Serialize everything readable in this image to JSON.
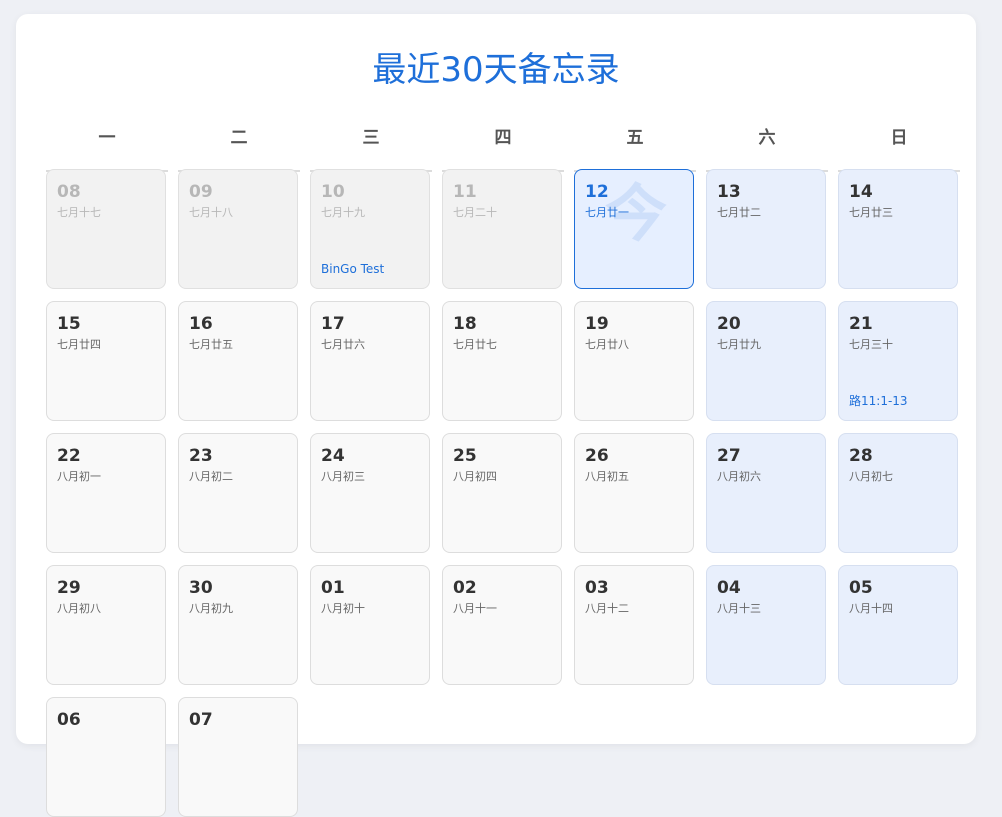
{
  "header": {
    "title": "最近30天备忘录"
  },
  "weekdays": [
    "一",
    "二",
    "三",
    "四",
    "五",
    "六",
    "日"
  ],
  "today_mark": "今",
  "days": [
    {
      "day": "08",
      "lunar": "七月十七",
      "state": "past",
      "memo": ""
    },
    {
      "day": "09",
      "lunar": "七月十八",
      "state": "past",
      "memo": ""
    },
    {
      "day": "10",
      "lunar": "七月十九",
      "state": "past",
      "memo": "BinGo Test"
    },
    {
      "day": "11",
      "lunar": "七月二十",
      "state": "past",
      "memo": ""
    },
    {
      "day": "12",
      "lunar": "七月廿一",
      "state": "today",
      "memo": ""
    },
    {
      "day": "13",
      "lunar": "七月廿二",
      "state": "weekend",
      "memo": ""
    },
    {
      "day": "14",
      "lunar": "七月廿三",
      "state": "weekend",
      "memo": ""
    },
    {
      "day": "15",
      "lunar": "七月廿四",
      "state": "normal",
      "memo": ""
    },
    {
      "day": "16",
      "lunar": "七月廿五",
      "state": "normal",
      "memo": ""
    },
    {
      "day": "17",
      "lunar": "七月廿六",
      "state": "normal",
      "memo": ""
    },
    {
      "day": "18",
      "lunar": "七月廿七",
      "state": "normal",
      "memo": ""
    },
    {
      "day": "19",
      "lunar": "七月廿八",
      "state": "normal",
      "memo": ""
    },
    {
      "day": "20",
      "lunar": "七月廿九",
      "state": "weekend",
      "memo": ""
    },
    {
      "day": "21",
      "lunar": "七月三十",
      "state": "weekend",
      "memo": "路11:1-13"
    },
    {
      "day": "22",
      "lunar": "八月初一",
      "state": "normal",
      "memo": ""
    },
    {
      "day": "23",
      "lunar": "八月初二",
      "state": "normal",
      "memo": ""
    },
    {
      "day": "24",
      "lunar": "八月初三",
      "state": "normal",
      "memo": ""
    },
    {
      "day": "25",
      "lunar": "八月初四",
      "state": "normal",
      "memo": ""
    },
    {
      "day": "26",
      "lunar": "八月初五",
      "state": "normal",
      "memo": ""
    },
    {
      "day": "27",
      "lunar": "八月初六",
      "state": "weekend",
      "memo": ""
    },
    {
      "day": "28",
      "lunar": "八月初七",
      "state": "weekend",
      "memo": ""
    },
    {
      "day": "29",
      "lunar": "八月初八",
      "state": "normal",
      "memo": ""
    },
    {
      "day": "30",
      "lunar": "八月初九",
      "state": "normal",
      "memo": ""
    },
    {
      "day": "01",
      "lunar": "八月初十",
      "state": "normal",
      "memo": ""
    },
    {
      "day": "02",
      "lunar": "八月十一",
      "state": "normal",
      "memo": ""
    },
    {
      "day": "03",
      "lunar": "八月十二",
      "state": "normal",
      "memo": ""
    },
    {
      "day": "04",
      "lunar": "八月十三",
      "state": "weekend",
      "memo": ""
    },
    {
      "day": "05",
      "lunar": "八月十四",
      "state": "weekend",
      "memo": ""
    },
    {
      "day": "06",
      "lunar": "",
      "state": "normal",
      "memo": ""
    },
    {
      "day": "07",
      "lunar": "",
      "state": "normal",
      "memo": ""
    }
  ]
}
